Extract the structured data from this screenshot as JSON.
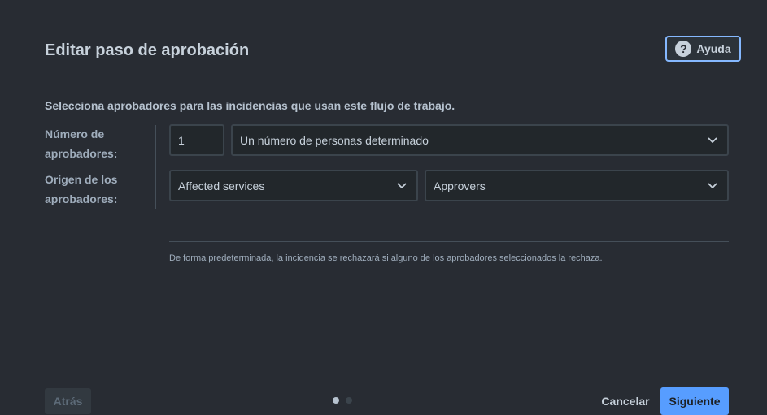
{
  "dialog": {
    "title": "Editar paso de aprobación",
    "help_label": "Ayuda",
    "description": "Selecciona aprobadores para las incidencias que usan este flujo de trabajo."
  },
  "form": {
    "count_label": "Número de aprobadores:",
    "count_value": "1",
    "type_value": "Un número de personas determinado",
    "origin_label": "Origen de los aprobadores:",
    "source_value": "Affected services",
    "field_value": "Approvers"
  },
  "note": "De forma predeterminada, la incidencia se rechazará si alguno de los aprobadores seleccionados la rechaza.",
  "footer": {
    "back_label": "Atrás",
    "cancel_label": "Cancelar",
    "next_label": "Siguiente",
    "steps_total": 2,
    "step_current": 1
  },
  "colors": {
    "background": "#282c33",
    "primary": "#579dff",
    "focus_ring": "#85b8ff"
  },
  "icons": {
    "help": "question-circle-icon",
    "dropdown": "chevron-down-icon"
  }
}
